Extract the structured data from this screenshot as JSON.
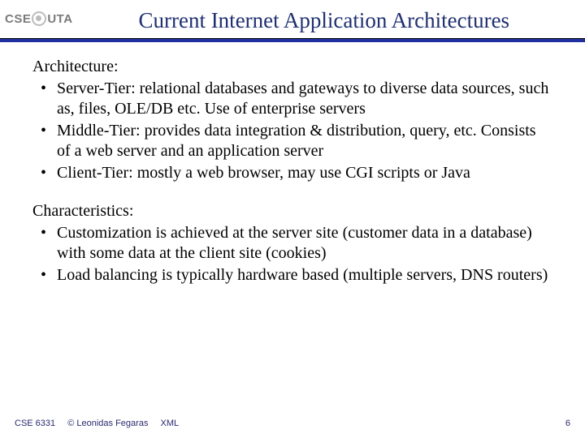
{
  "header": {
    "logo_left": "CSE",
    "logo_right": "UTA",
    "title": "Current Internet Application Architectures"
  },
  "sections": [
    {
      "heading": "Architecture:",
      "items": [
        "Server-Tier: relational databases and gateways to diverse data sources, such as, files, OLE/DB etc. Use of enterprise servers",
        "Middle-Tier: provides data integration & distribution, query, etc. Consists of a web server and an application server",
        "Client-Tier: mostly a web browser, may use CGI scripts or Java"
      ]
    },
    {
      "heading": "Characteristics:",
      "items": [
        "Customization is achieved at the server site (customer data in a database) with some data at the client site (cookies)",
        "Load balancing is typically hardware based (multiple servers, DNS routers)"
      ]
    }
  ],
  "footer": {
    "course": "CSE 6331",
    "copyright": "© Leonidas Fegaras",
    "topic": "XML",
    "page": "6"
  }
}
